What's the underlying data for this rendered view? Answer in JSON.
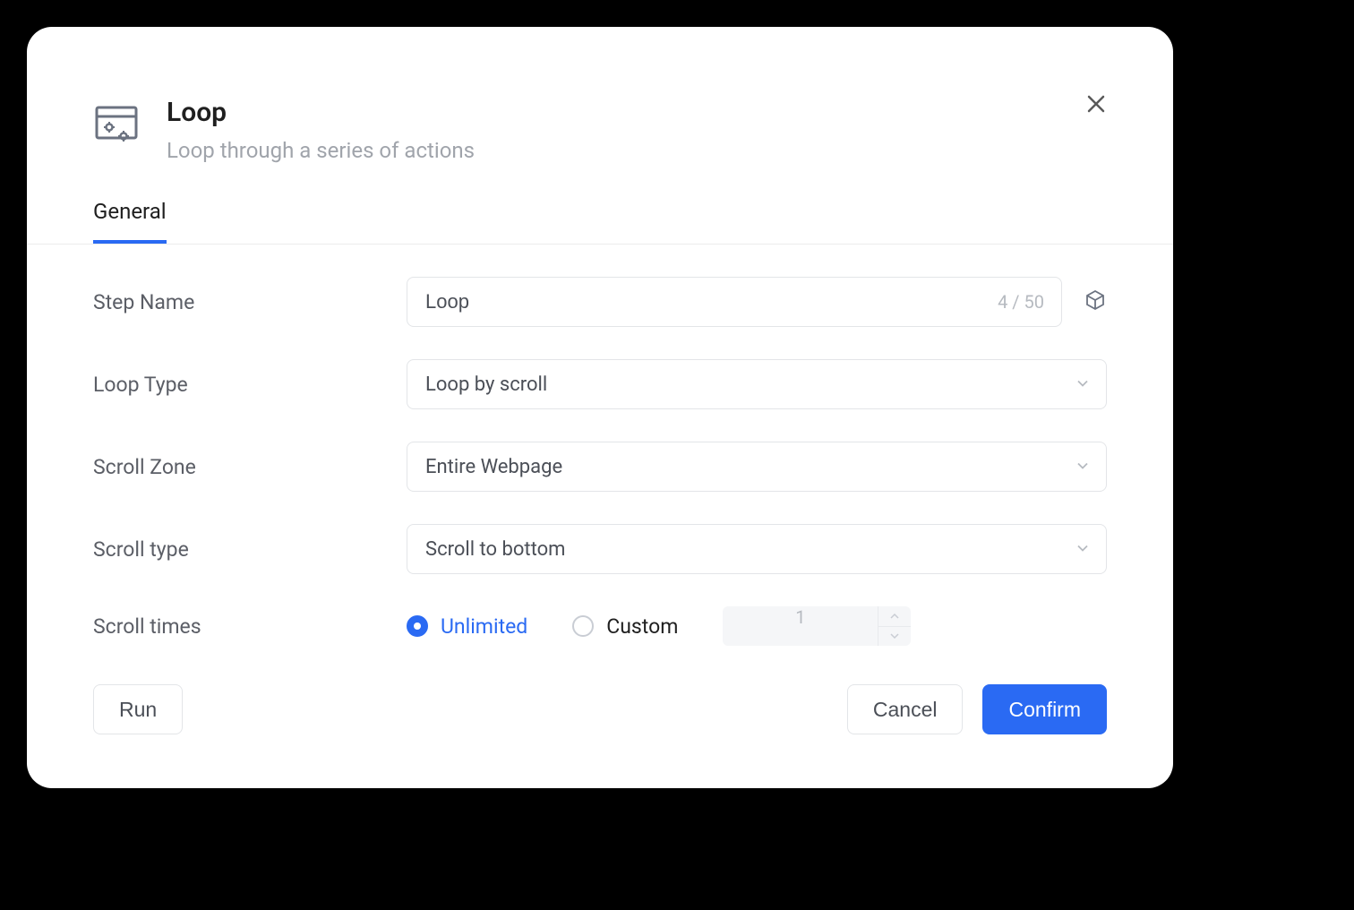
{
  "header": {
    "title": "Loop",
    "subtitle": "Loop through a series of actions"
  },
  "tabs": {
    "general": "General"
  },
  "form": {
    "step_name": {
      "label": "Step Name",
      "value": "Loop",
      "counter": "4 / 50"
    },
    "loop_type": {
      "label": "Loop Type",
      "value": "Loop by scroll"
    },
    "scroll_zone": {
      "label": "Scroll Zone",
      "value": "Entire Webpage"
    },
    "scroll_type": {
      "label": "Scroll type",
      "value": "Scroll to bottom"
    },
    "scroll_times": {
      "label": "Scroll times",
      "unlimited": "Unlimited",
      "custom": "Custom",
      "custom_value": "1"
    }
  },
  "footer": {
    "run": "Run",
    "cancel": "Cancel",
    "confirm": "Confirm"
  }
}
